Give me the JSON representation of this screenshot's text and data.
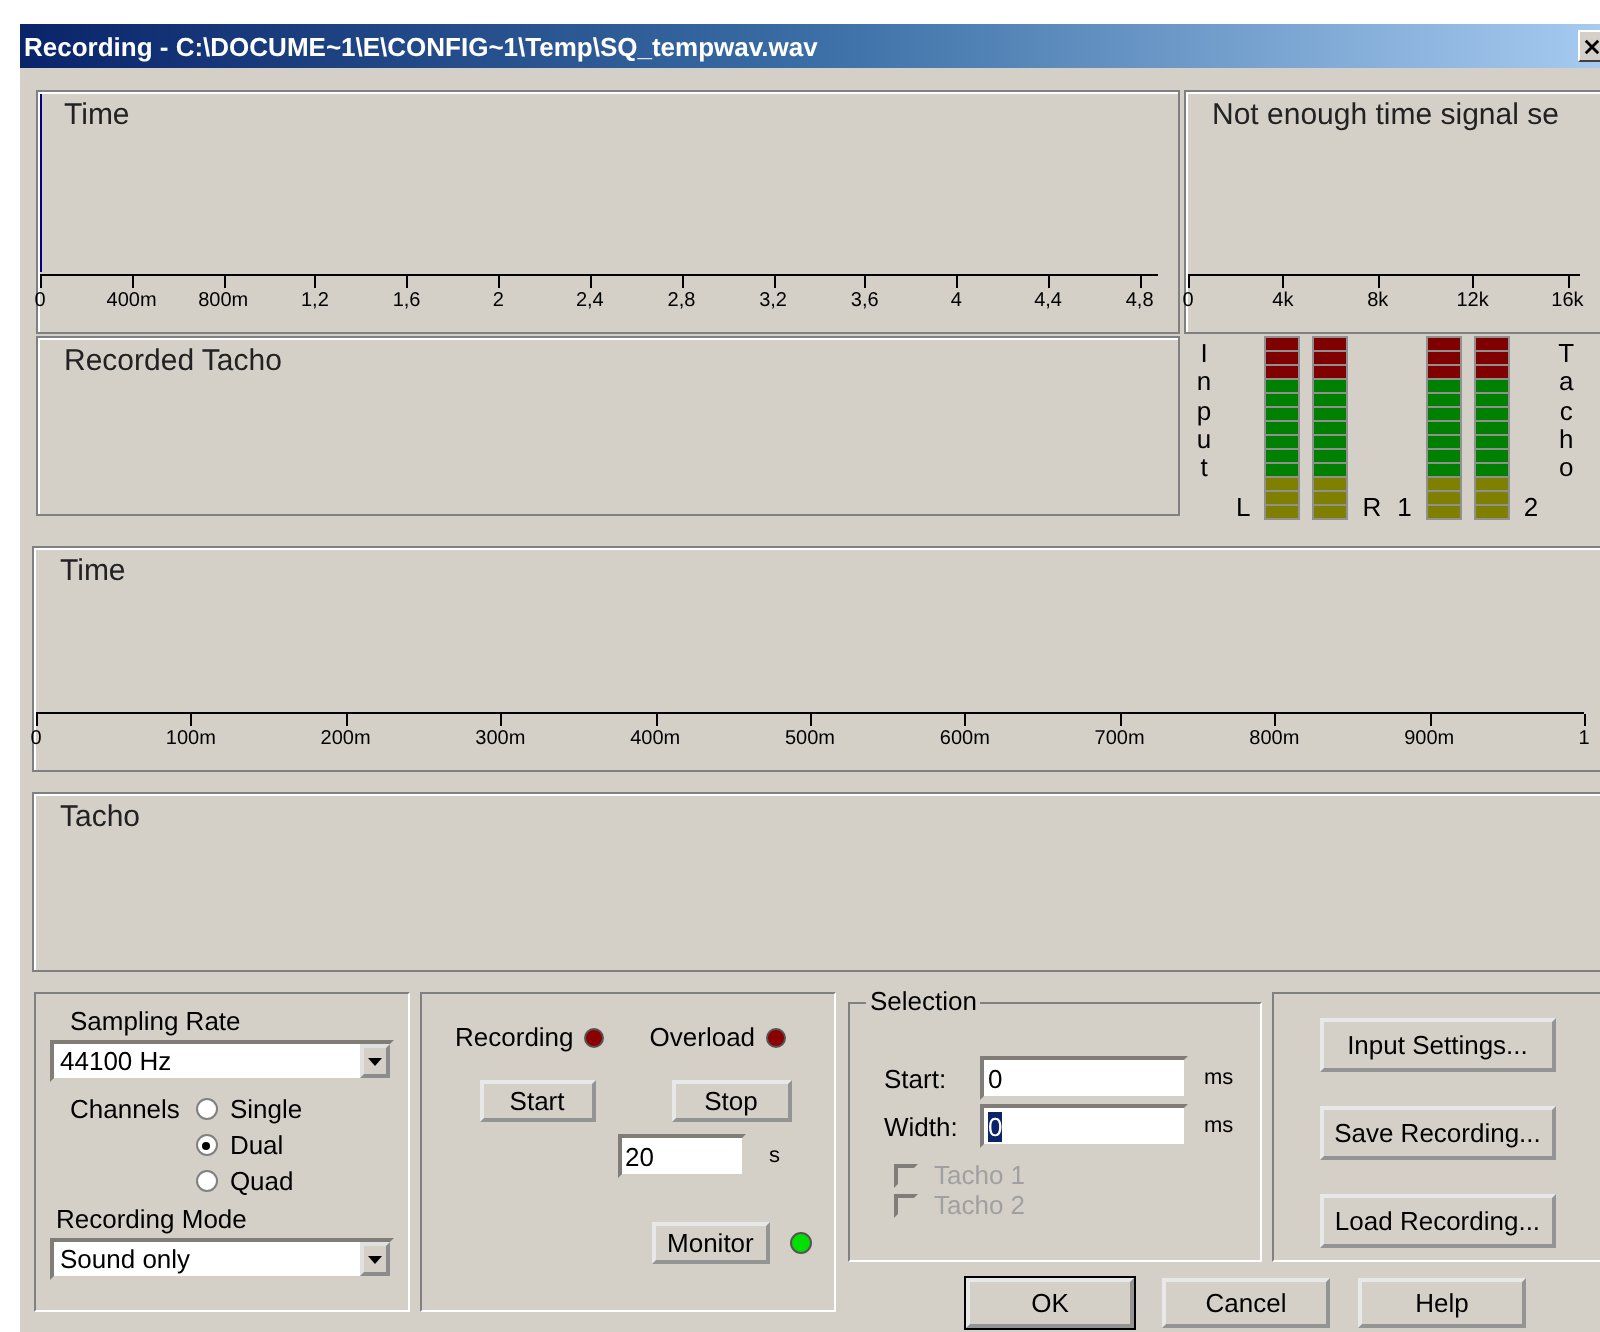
{
  "window": {
    "title": "Recording - C:\\DOCUME~1\\E\\CONFIG~1\\Temp\\SQ_tempwav.wav"
  },
  "time_signal": {
    "title": "Time",
    "ticks": [
      "0",
      "400m",
      "800m",
      "1,2",
      "1,6",
      "2",
      "2,4",
      "2,8",
      "3,2",
      "3,6",
      "4",
      "4,4",
      "4,8"
    ]
  },
  "spectrum": {
    "title": "Not enough time signal se",
    "ticks": [
      "0",
      "4k",
      "8k",
      "12k",
      "16k"
    ]
  },
  "recorded_tacho": {
    "title": "Recorded Tacho"
  },
  "meters": {
    "input_label": "Input",
    "tacho_label": "Tacho",
    "channels": [
      {
        "label": "L",
        "level": 1
      },
      {
        "label": "R",
        "level": 1
      },
      {
        "label": "1",
        "level": 1
      },
      {
        "label": "2",
        "level": 1
      }
    ]
  },
  "time": {
    "title": "Time",
    "ticks": [
      "0",
      "100m",
      "200m",
      "300m",
      "400m",
      "500m",
      "600m",
      "700m",
      "800m",
      "900m",
      "1"
    ]
  },
  "tacho": {
    "title": "Tacho"
  },
  "sampling": {
    "rate_label": "Sampling Rate",
    "rate_value": "44100 Hz",
    "channels_label": "Channels",
    "channels": [
      {
        "label": "Single",
        "selected": false
      },
      {
        "label": "Dual",
        "selected": true
      },
      {
        "label": "Quad",
        "selected": false
      }
    ],
    "mode_label": "Recording Mode",
    "mode_value": "Sound only"
  },
  "recording": {
    "indicators": [
      {
        "label": "Recording",
        "lit": false
      },
      {
        "label": "Overload",
        "lit": false
      }
    ],
    "start": "Start",
    "stop": "Stop",
    "duration": "20",
    "duration_unit": "s",
    "monitor": "Monitor",
    "monitor_lit": true
  },
  "selection": {
    "legend": "Selection",
    "fields": [
      {
        "label": "Start:",
        "value": "0",
        "unit": "ms"
      },
      {
        "label": "Width:",
        "value": "0",
        "unit": "ms"
      }
    ],
    "checkboxes": [
      {
        "label": "Tacho 1",
        "checked": false,
        "disabled": true
      },
      {
        "label": "Tacho 2",
        "checked": false,
        "disabled": true
      }
    ]
  },
  "actions": [
    "Input Settings...",
    "Save Recording...",
    "Load Recording..."
  ],
  "buttons": [
    {
      "label": "OK",
      "default": true
    },
    {
      "label": "Cancel",
      "default": false
    },
    {
      "label": "Help",
      "default": false
    }
  ]
}
